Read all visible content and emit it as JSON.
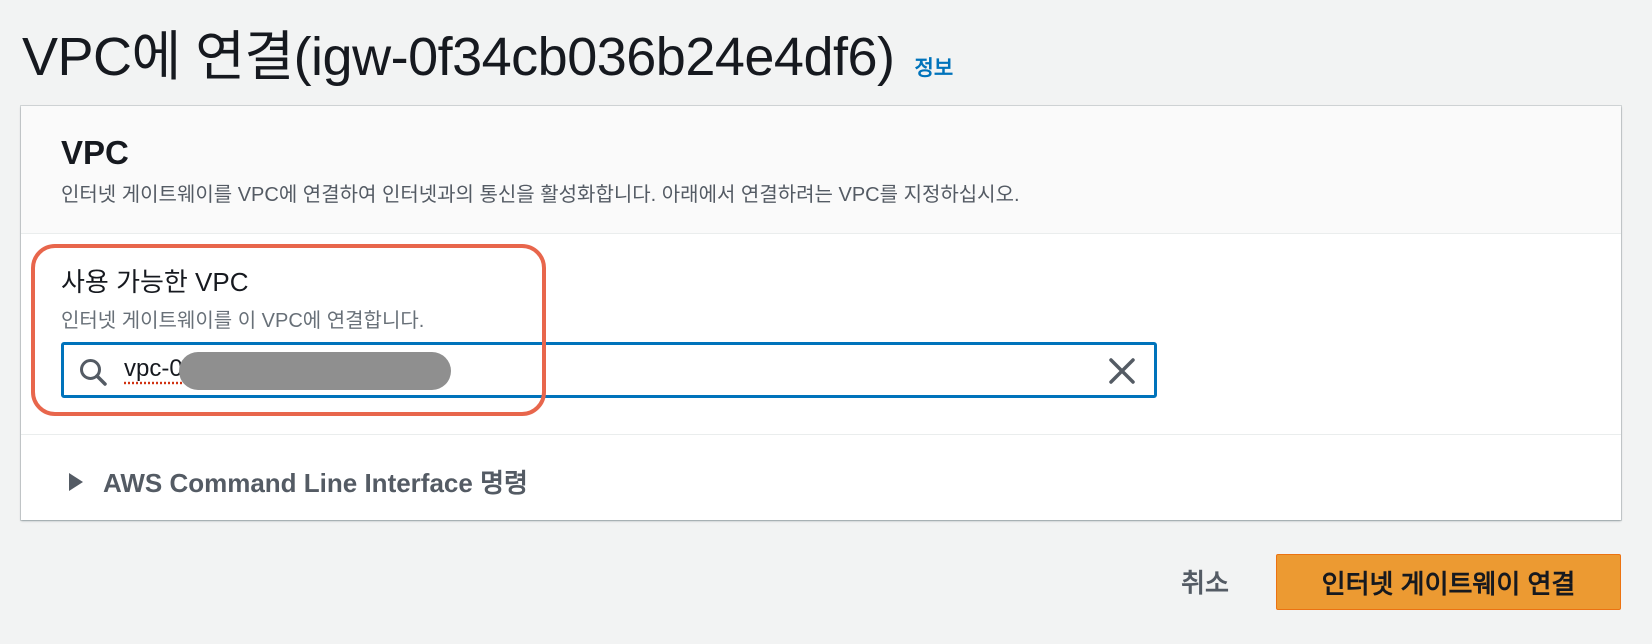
{
  "header": {
    "title": "VPC에 연결(igw-0f34cb036b24e4df6)",
    "info_link": "정보"
  },
  "panel": {
    "title": "VPC",
    "description": "인터넷 게이트웨이를 VPC에 연결하여 인터넷과의 통신을 활성화합니다. 아래에서 연결하려는 VPC를 지정하십시오."
  },
  "vpc_field": {
    "label": "사용 가능한 VPC",
    "description": "인터넷 게이트웨이를 이 VPC에 연결합니다.",
    "value": "vpc-0"
  },
  "cli": {
    "label": "AWS Command Line Interface 명령"
  },
  "actions": {
    "cancel_label": "취소",
    "attach_label": "인터넷 게이트웨이 연결"
  },
  "colors": {
    "accent": "#0073bb",
    "primary_button": "#ec9a32",
    "highlight": "#e8664c"
  }
}
